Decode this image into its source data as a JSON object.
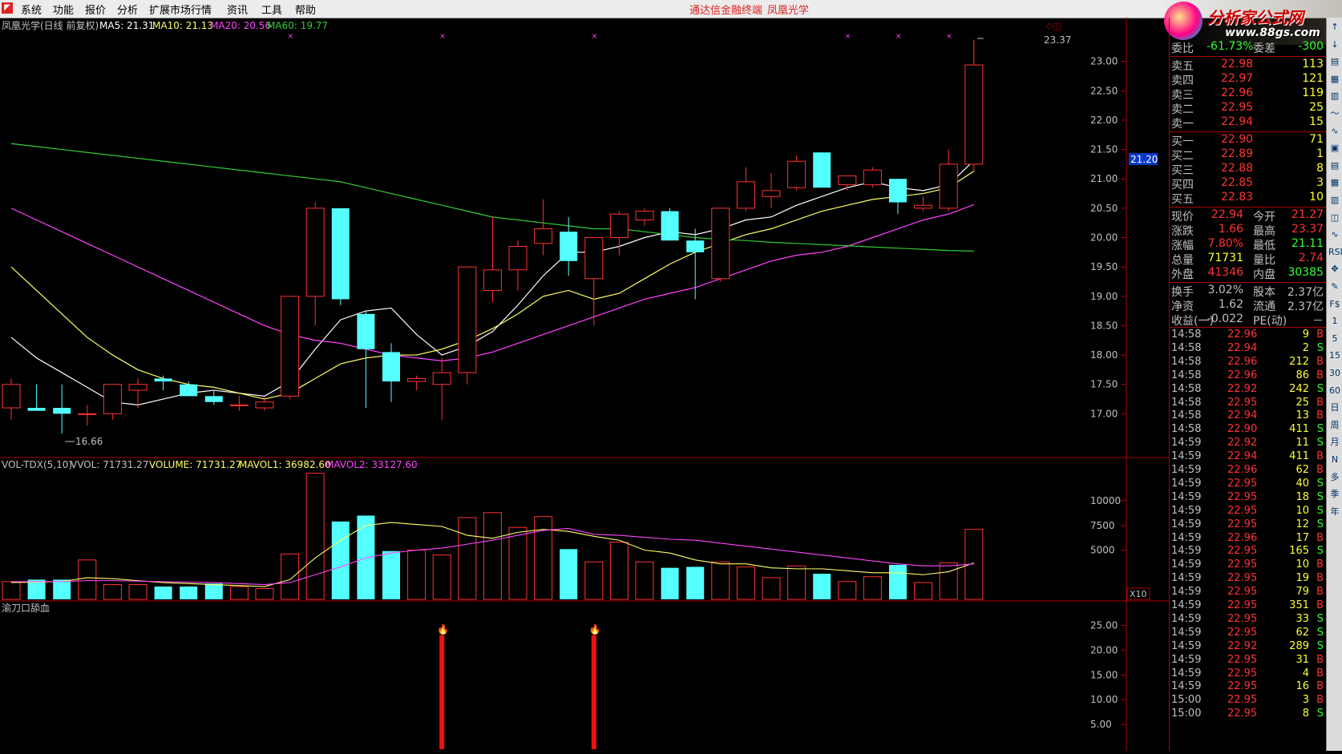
{
  "menu": {
    "items": [
      "系统",
      "功能",
      "报价",
      "分析",
      "扩展市场行情",
      "资讯",
      "工具",
      "帮助"
    ],
    "center_title": "通达信金融终端",
    "center_stock": "凤凰光学"
  },
  "watermark": {
    "title": "分析家公式网",
    "url": "www.88gs.com"
  },
  "main_chart": {
    "header_name": "凤凰光学(日线 前复权)",
    "ma5": "MA5: 21.31",
    "ma10": "MA10: 21.13",
    "ma20": "MA20: 20.56",
    "ma60": "MA60: 19.77",
    "high_label": "23.37",
    "low_label": "16.66",
    "current_price_tag": "21.20",
    "y_ticks": [
      "23.00",
      "22.50",
      "22.00",
      "21.50",
      "21.00",
      "20.50",
      "20.00",
      "19.50",
      "19.00",
      "18.50",
      "18.00",
      "17.50",
      "17.00"
    ]
  },
  "chart_data": [
    {
      "type": "candlestick",
      "title": "凤凰光学(日线 前复权)",
      "ylim": [
        16.5,
        23.5
      ],
      "candles": [
        {
          "o": 17.1,
          "h": 17.6,
          "l": 16.9,
          "c": 17.5
        },
        {
          "o": 17.1,
          "h": 17.5,
          "l": 17.05,
          "c": 17.05
        },
        {
          "o": 17.1,
          "h": 17.5,
          "l": 16.66,
          "c": 17.0
        },
        {
          "o": 17.0,
          "h": 17.15,
          "l": 16.8,
          "c": 17.0
        },
        {
          "o": 17.0,
          "h": 17.5,
          "l": 16.9,
          "c": 17.5
        },
        {
          "o": 17.4,
          "h": 17.6,
          "l": 17.1,
          "c": 17.5
        },
        {
          "o": 17.6,
          "h": 17.65,
          "l": 17.4,
          "c": 17.55
        },
        {
          "o": 17.5,
          "h": 17.55,
          "l": 17.3,
          "c": 17.3
        },
        {
          "o": 17.3,
          "h": 17.4,
          "l": 17.15,
          "c": 17.2
        },
        {
          "o": 17.15,
          "h": 17.3,
          "l": 17.05,
          "c": 17.15
        },
        {
          "o": 17.1,
          "h": 17.3,
          "l": 17.05,
          "c": 17.2
        },
        {
          "o": 17.3,
          "h": 19.0,
          "l": 17.25,
          "c": 19.0
        },
        {
          "o": 19.0,
          "h": 20.6,
          "l": 18.5,
          "c": 20.5
        },
        {
          "o": 20.5,
          "h": 20.5,
          "l": 18.85,
          "c": 18.95
        },
        {
          "o": 18.7,
          "h": 18.75,
          "l": 17.1,
          "c": 18.1
        },
        {
          "o": 18.05,
          "h": 18.2,
          "l": 17.2,
          "c": 17.55
        },
        {
          "o": 17.55,
          "h": 17.65,
          "l": 17.4,
          "c": 17.6
        },
        {
          "o": 17.5,
          "h": 17.95,
          "l": 16.9,
          "c": 17.7
        },
        {
          "o": 17.7,
          "h": 19.5,
          "l": 17.5,
          "c": 19.5
        },
        {
          "o": 19.1,
          "h": 20.35,
          "l": 18.9,
          "c": 19.45
        },
        {
          "o": 19.45,
          "h": 19.95,
          "l": 19.1,
          "c": 19.85
        },
        {
          "o": 19.9,
          "h": 20.65,
          "l": 19.7,
          "c": 20.15
        },
        {
          "o": 20.1,
          "h": 20.35,
          "l": 19.35,
          "c": 19.6
        },
        {
          "o": 19.3,
          "h": 20.0,
          "l": 18.5,
          "c": 20.0
        },
        {
          "o": 20.0,
          "h": 20.45,
          "l": 19.7,
          "c": 20.4
        },
        {
          "o": 20.3,
          "h": 20.5,
          "l": 20.2,
          "c": 20.45
        },
        {
          "o": 20.45,
          "h": 20.5,
          "l": 19.95,
          "c": 19.95
        },
        {
          "o": 19.95,
          "h": 20.15,
          "l": 18.95,
          "c": 19.75
        },
        {
          "o": 19.3,
          "h": 20.5,
          "l": 19.25,
          "c": 20.5
        },
        {
          "o": 20.5,
          "h": 21.2,
          "l": 20.45,
          "c": 20.95
        },
        {
          "o": 20.7,
          "h": 21.1,
          "l": 20.5,
          "c": 20.8
        },
        {
          "o": 20.85,
          "h": 21.4,
          "l": 20.8,
          "c": 21.3
        },
        {
          "o": 21.45,
          "h": 21.45,
          "l": 20.85,
          "c": 20.85
        },
        {
          "o": 20.9,
          "h": 21.05,
          "l": 20.8,
          "c": 21.05
        },
        {
          "o": 20.9,
          "h": 21.2,
          "l": 20.85,
          "c": 21.15
        },
        {
          "o": 21.0,
          "h": 21.0,
          "l": 20.4,
          "c": 20.6
        },
        {
          "o": 20.5,
          "h": 20.7,
          "l": 20.45,
          "c": 20.55
        },
        {
          "o": 20.5,
          "h": 21.5,
          "l": 20.45,
          "c": 21.25
        },
        {
          "o": 21.25,
          "h": 23.37,
          "l": 21.11,
          "c": 22.94
        }
      ],
      "ma_lines": {
        "MA5": [
          18.3,
          17.95,
          17.7,
          17.45,
          17.2,
          17.15,
          17.25,
          17.35,
          17.4,
          17.35,
          17.3,
          17.55,
          18.1,
          18.6,
          18.75,
          18.8,
          18.35,
          18.0,
          18.15,
          18.4,
          18.85,
          19.35,
          19.75,
          19.75,
          19.85,
          20.0,
          20.1,
          20.05,
          20.15,
          20.3,
          20.35,
          20.55,
          20.7,
          20.85,
          20.95,
          20.85,
          20.8,
          20.9,
          21.31
        ],
        "MA10": [
          19.5,
          19.1,
          18.7,
          18.3,
          18.0,
          17.75,
          17.6,
          17.5,
          17.45,
          17.35,
          17.25,
          17.35,
          17.6,
          17.85,
          17.95,
          18.0,
          18.0,
          18.1,
          18.25,
          18.45,
          18.7,
          19.0,
          19.1,
          18.95,
          19.05,
          19.3,
          19.55,
          19.75,
          19.9,
          20.05,
          20.15,
          20.3,
          20.45,
          20.55,
          20.65,
          20.7,
          20.75,
          20.85,
          21.13
        ],
        "MA20": [
          20.5,
          20.3,
          20.1,
          19.9,
          19.7,
          19.5,
          19.3,
          19.1,
          18.9,
          18.7,
          18.5,
          18.35,
          18.25,
          18.2,
          18.1,
          18.0,
          17.95,
          17.9,
          17.95,
          18.05,
          18.2,
          18.35,
          18.5,
          18.65,
          18.8,
          18.95,
          19.05,
          19.15,
          19.3,
          19.45,
          19.6,
          19.7,
          19.75,
          19.85,
          20.0,
          20.15,
          20.3,
          20.4,
          20.56
        ],
        "MA60": [
          21.6,
          21.55,
          21.5,
          21.45,
          21.4,
          21.35,
          21.3,
          21.25,
          21.2,
          21.15,
          21.1,
          21.05,
          21.0,
          20.95,
          20.85,
          20.75,
          20.65,
          20.55,
          20.45,
          20.35,
          20.3,
          20.25,
          20.2,
          20.15,
          20.15,
          20.1,
          20.05,
          20.0,
          19.97,
          19.95,
          19.92,
          19.9,
          19.88,
          19.86,
          19.84,
          19.82,
          19.8,
          19.78,
          19.77
        ]
      },
      "ma_colors": {
        "MA5": "#ffffff",
        "MA10": "#ffff66",
        "MA20": "#ff44ff",
        "MA60": "#33cc33"
      }
    },
    {
      "type": "bar",
      "title": "VOL-TDX(5,10)",
      "ylim": [
        0,
        13500
      ],
      "values": [
        1800,
        2000,
        2000,
        4000,
        1500,
        1500,
        1300,
        1300,
        1600,
        1300,
        1100,
        4600,
        12800,
        7900,
        8500,
        4900,
        5000,
        4500,
        8300,
        8800,
        7300,
        8400,
        5100,
        3800,
        5800,
        3800,
        3200,
        3300,
        3800,
        3300,
        2200,
        3400,
        2600,
        1800,
        2300,
        3500,
        1700,
        3700,
        7100
      ],
      "mavol1": [
        1700,
        1750,
        1800,
        2200,
        2100,
        1900,
        1700,
        1600,
        1500,
        1400,
        1300,
        2000,
        4200,
        6000,
        7500,
        7800,
        7600,
        7400,
        6500,
        6200,
        6800,
        7100,
        6900,
        6400,
        6000,
        5000,
        4700,
        4000,
        3600,
        3600,
        3200,
        3100,
        3100,
        2900,
        2700,
        2700,
        2500,
        2800,
        3700
      ],
      "mavol2": [
        1800,
        1800,
        1800,
        1900,
        1900,
        1850,
        1800,
        1750,
        1700,
        1600,
        1500,
        1700,
        2500,
        3300,
        4200,
        4700,
        5000,
        5200,
        5600,
        6000,
        6500,
        7000,
        7200,
        6600,
        6500,
        6300,
        6100,
        6000,
        5700,
        5400,
        5100,
        4800,
        4500,
        4200,
        3900,
        3600,
        3400,
        3400,
        3600
      ],
      "labels": {
        "name": "VOL-TDX(5,10)",
        "vvol": "VVOL: 71731.27",
        "volume": "VOLUME: 71731.27",
        "mavol1": "MAVOL1: 36982.60",
        "mavol2": "MAVOL2: 33127.60"
      },
      "y_ticks": [
        "10000",
        "7500",
        "5000"
      ],
      "unit_tag": "X10"
    },
    {
      "type": "bar",
      "title": "渝刀口舔血",
      "ylim": [
        0,
        28
      ],
      "signal_indices": [
        17,
        23
      ],
      "signal_value": 25,
      "y_ticks": [
        "25.00",
        "20.00",
        "15.00",
        "10.00",
        "5.00"
      ]
    }
  ],
  "quote": {
    "weibi_label": "委比",
    "weibi_value": "-61.73%",
    "weicha_label": "委差",
    "weicha_value": "-300",
    "asks": [
      {
        "label": "卖五",
        "price": "22.98",
        "vol": "113"
      },
      {
        "label": "卖四",
        "price": "22.97",
        "vol": "121"
      },
      {
        "label": "卖三",
        "price": "22.96",
        "vol": "119"
      },
      {
        "label": "卖二",
        "price": "22.95",
        "vol": "25"
      },
      {
        "label": "卖一",
        "price": "22.94",
        "vol": "15"
      }
    ],
    "bids": [
      {
        "label": "买一",
        "price": "22.90",
        "vol": "71"
      },
      {
        "label": "买二",
        "price": "22.89",
        "vol": "1"
      },
      {
        "label": "买三",
        "price": "22.88",
        "vol": "8"
      },
      {
        "label": "买四",
        "price": "22.85",
        "vol": "3"
      },
      {
        "label": "买五",
        "price": "22.83",
        "vol": "10"
      }
    ],
    "stats": [
      {
        "l1": "现价",
        "v1": "22.94",
        "l2": "今开",
        "v2": "21.27",
        "c1": "#ff3333",
        "c2": "#ff3333"
      },
      {
        "l1": "涨跌",
        "v1": "1.66",
        "l2": "最高",
        "v2": "23.37",
        "c1": "#ff3333",
        "c2": "#ff3333"
      },
      {
        "l1": "涨幅",
        "v1": "7.80%",
        "l2": "最低",
        "v2": "21.11",
        "c1": "#ff3333",
        "c2": "#33ff33"
      },
      {
        "l1": "总量",
        "v1": "71731",
        "l2": "量比",
        "v2": "2.74",
        "c1": "#ffff33",
        "c2": "#ff3333"
      },
      {
        "l1": "外盘",
        "v1": "41346",
        "l2": "内盘",
        "v2": "30385",
        "c1": "#ff3333",
        "c2": "#33ff33"
      }
    ],
    "stats2": [
      {
        "l1": "换手",
        "v1": "3.02%",
        "l2": "股本",
        "v2": "2.37亿"
      },
      {
        "l1": "净资",
        "v1": "1.62",
        "l2": "流通",
        "v2": "2.37亿"
      },
      {
        "l1": "收益(一)",
        "v1": "-0.022",
        "l2": "PE(动)",
        "v2": "－"
      }
    ]
  },
  "ticks": [
    {
      "t": "14:58",
      "p": "22.96",
      "v": "9",
      "d": "B"
    },
    {
      "t": "14:58",
      "p": "22.94",
      "v": "2",
      "d": "S"
    },
    {
      "t": "14:58",
      "p": "22.96",
      "v": "212",
      "d": "B"
    },
    {
      "t": "14:58",
      "p": "22.96",
      "v": "86",
      "d": "B"
    },
    {
      "t": "14:58",
      "p": "22.92",
      "v": "242",
      "d": "S"
    },
    {
      "t": "14:58",
      "p": "22.95",
      "v": "25",
      "d": "B"
    },
    {
      "t": "14:58",
      "p": "22.94",
      "v": "13",
      "d": "B"
    },
    {
      "t": "14:58",
      "p": "22.90",
      "v": "411",
      "d": "S"
    },
    {
      "t": "14:59",
      "p": "22.92",
      "v": "11",
      "d": "S"
    },
    {
      "t": "14:59",
      "p": "22.94",
      "v": "411",
      "d": "B"
    },
    {
      "t": "14:59",
      "p": "22.96",
      "v": "62",
      "d": "B"
    },
    {
      "t": "14:59",
      "p": "22.95",
      "v": "40",
      "d": "S"
    },
    {
      "t": "14:59",
      "p": "22.95",
      "v": "18",
      "d": "S"
    },
    {
      "t": "14:59",
      "p": "22.95",
      "v": "10",
      "d": "S"
    },
    {
      "t": "14:59",
      "p": "22.95",
      "v": "12",
      "d": "S"
    },
    {
      "t": "14:59",
      "p": "22.96",
      "v": "17",
      "d": "B"
    },
    {
      "t": "14:59",
      "p": "22.95",
      "v": "165",
      "d": "S"
    },
    {
      "t": "14:59",
      "p": "22.95",
      "v": "10",
      "d": "B"
    },
    {
      "t": "14:59",
      "p": "22.95",
      "v": "19",
      "d": "B"
    },
    {
      "t": "14:59",
      "p": "22.95",
      "v": "79",
      "d": "B"
    },
    {
      "t": "14:59",
      "p": "22.95",
      "v": "351",
      "d": "B"
    },
    {
      "t": "14:59",
      "p": "22.95",
      "v": "33",
      "d": "S"
    },
    {
      "t": "14:59",
      "p": "22.95",
      "v": "62",
      "d": "S"
    },
    {
      "t": "14:59",
      "p": "22.92",
      "v": "289",
      "d": "S"
    },
    {
      "t": "14:59",
      "p": "22.95",
      "v": "31",
      "d": "B"
    },
    {
      "t": "14:59",
      "p": "22.95",
      "v": "4",
      "d": "B"
    },
    {
      "t": "14:59",
      "p": "22.95",
      "v": "16",
      "d": "B"
    },
    {
      "t": "15:00",
      "p": "22.95",
      "v": "3",
      "d": "B"
    },
    {
      "t": "15:00",
      "p": "22.95",
      "v": "8",
      "d": "S"
    }
  ],
  "side_icons": [
    "↑",
    "↓",
    "▤",
    "▦",
    "▥",
    "〜",
    "∿",
    "▣",
    "▤",
    "▦",
    "▥",
    "◫",
    "∿",
    "RSI",
    "✥",
    "✎",
    "F$",
    "1",
    "5",
    "15",
    "30",
    "60",
    "日",
    "周",
    "月",
    "N",
    "多",
    "季",
    "年"
  ]
}
